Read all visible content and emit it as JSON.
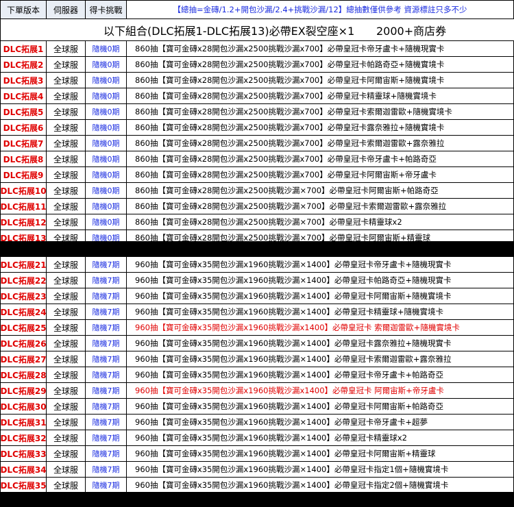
{
  "header": {
    "version_label": "下單版本",
    "server_label": "伺服器",
    "challenge_label": "得卡挑戰",
    "note": "【總抽=金磚/1.2+開包沙漏/2.4+挑戰沙漏/12】總抽數僅供參考 資源標註只多不少"
  },
  "title": {
    "combo": "以下組合(DLC拓展1-DLC拓展13)必帶EX裂空座×1",
    "shop": "2000+商店券"
  },
  "group1": [
    {
      "version": "DLC拓展1",
      "server": "全球服",
      "challenge": "隨機0期",
      "desc": "860抽【寶可金磚x28開包沙漏x2500挑戰沙漏x700】必帶皇冠卡帝牙盧卡+隨機現實卡"
    },
    {
      "version": "DLC拓展2",
      "server": "全球服",
      "challenge": "隨機0期",
      "desc": "860抽【寶可金磚x28開包沙漏x2500挑戰沙漏x700】必帶皇冠卡帕路奇亞+隨機實境卡"
    },
    {
      "version": "DLC拓展3",
      "server": "全球服",
      "challenge": "隨機0期",
      "desc": "860抽【寶可金磚x28開包沙漏x2500挑戰沙漏x700】必帶皇冠卡阿爾宙斯+隨機實境卡"
    },
    {
      "version": "DLC拓展4",
      "server": "全球服",
      "challenge": "隨機0期",
      "desc": "860抽【寶可金磚x28開包沙漏x2500挑戰沙漏x700】必帶皇冠卡精靈球+隨機實境卡"
    },
    {
      "version": "DLC拓展5",
      "server": "全球服",
      "challenge": "隨機0期",
      "desc": "860抽【寶可金磚x28開包沙漏x2500挑戰沙漏x700】必帶皇冠卡索爾迦雷歐+隨機實境卡"
    },
    {
      "version": "DLC拓展6",
      "server": "全球服",
      "challenge": "隨機0期",
      "desc": "860抽【寶可金磚x28開包沙漏x2500挑戰沙漏x700】必帶皇冠卡露奈雅拉+隨機實境卡"
    },
    {
      "version": "DLC拓展7",
      "server": "全球服",
      "challenge": "隨機0期",
      "desc": "860抽【寶可金磚x28開包沙漏x2500挑戰沙漏x700】必帶皇冠卡索爾迦雷歐+露奈雅拉"
    },
    {
      "version": "DLC拓展8",
      "server": "全球服",
      "challenge": "隨機0期",
      "desc": "860抽【寶可金磚x28開包沙漏x2500挑戰沙漏x700】必帶皇冠卡帝牙盧卡+帕路奇亞"
    },
    {
      "version": "DLC拓展9",
      "server": "全球服",
      "challenge": "隨機0期",
      "desc": "860抽【寶可金磚x28開包沙漏x2500挑戰沙漏x700】必帶皇冠卡阿爾宙斯+帝牙盧卡"
    },
    {
      "version": "DLC拓展10",
      "server": "全球服",
      "challenge": "隨機0期",
      "desc": "860抽【寶可金磚x28開包沙漏x2500挑戰沙漏×700】必帶皇冠卡阿爾宙斯+帕路奇亞"
    },
    {
      "version": "DLC拓展11",
      "server": "全球服",
      "challenge": "隨機0期",
      "desc": "860抽【寶可金磚x28開包沙漏x2500挑戰沙漏×700】必帶皇冠卡索爾迦雷歐+露奈雅拉"
    },
    {
      "version": "DLC拓展12",
      "server": "全球服",
      "challenge": "隨機0期",
      "desc": "860抽【寶可金磚x28開包沙漏x2500挑戰沙漏×700】必帶皇冠卡精靈球x2"
    },
    {
      "version": "DLC拓展13",
      "server": "全球服",
      "challenge": "隨機0期",
      "desc": "860抽【寶可金磚x28開包沙漏x2500挑戰沙漏×700】必帶皇冠卡阿爾宙斯+精靈球"
    }
  ],
  "group2": [
    {
      "version": "DLC拓展21",
      "server": "全球服",
      "challenge": "隨機7期",
      "desc": "960抽【寶可金磚x35開包沙漏x1960挑戰沙漏×1400】必帶皇冠卡帝牙盧卡+隨機現實卡"
    },
    {
      "version": "DLC拓展22",
      "server": "全球服",
      "challenge": "隨機7期",
      "desc": "960抽【寶可金磚x35開包沙漏x1960挑戰沙漏×1400】必帶皇冠卡帕路奇亞+隨機現實卡"
    },
    {
      "version": "DLC拓展23",
      "server": "全球服",
      "challenge": "隨機7期",
      "desc": "960抽【寶可金磚x35開包沙漏x1960挑戰沙漏×1400】必帶皇冠卡阿爾宙斯+隨機實境卡"
    },
    {
      "version": "DLC拓展24",
      "server": "全球服",
      "challenge": "隨機7期",
      "desc": "960抽【寶可金磚x35開包沙漏x1960挑戰沙漏×1400】必帶皇冠卡精靈球+隨機實境卡"
    },
    {
      "version": "DLC拓展25",
      "server": "全球服",
      "challenge": "隨機7期",
      "desc": "960抽【寶可金磚x35開包沙漏x1960挑戰沙漏x1400】必帶皇冠卡 索爾迦雷歐+隨機實境卡",
      "highlight": true
    },
    {
      "version": "DLC拓展26",
      "server": "全球服",
      "challenge": "隨機7期",
      "desc": "960抽【寶可金磚x35開包沙漏x1960挑戰沙漏×1400】必帶皇冠卡露奈雅拉+隨機現實卡"
    },
    {
      "version": "DLC拓展27",
      "server": "全球服",
      "challenge": "隨機7期",
      "desc": "960抽【寶可金磚x35開包沙漏x1960挑戰沙漏×1400】必帶皇冠卡索爾迦雷歐+露奈雅拉"
    },
    {
      "version": "DLC拓展28",
      "server": "全球服",
      "challenge": "隨機7期",
      "desc": "960抽【寶可金磚x35開包沙漏x1960挑戰沙漏×1400】必帶皇冠卡帝牙盧卡+帕路奇亞"
    },
    {
      "version": "DLC拓展29",
      "server": "全球服",
      "challenge": "隨機7期",
      "desc": "960抽【寶可金磚x35開包沙漏x1960挑戰沙漏x1400】必帶皇冠卡 阿爾宙斯+帝牙盧卡",
      "highlight": true
    },
    {
      "version": "DLC拓展30",
      "server": "全球服",
      "challenge": "隨機7期",
      "desc": "960抽【寶可金磚x35開包沙漏x1960挑戰沙漏×1400】必帶皇冠卡阿爾宙斯+帕路奇亞"
    },
    {
      "version": "DLC拓展31",
      "server": "全球服",
      "challenge": "隨機7期",
      "desc": "960抽【寶可金磚x35開包沙漏x1960挑戰沙漏×1400】必帶皇冠卡帝牙盧卡+超夢"
    },
    {
      "version": "DLC拓展32",
      "server": "全球服",
      "challenge": "隨機7期",
      "desc": "960抽【寶可金磚x35開包沙漏x1960挑戰沙漏×1400】必帶皇冠卡精靈球x2"
    },
    {
      "version": "DLC拓展33",
      "server": "全球服",
      "challenge": "隨機7期",
      "desc": "960抽【寶可金磚x35開包沙漏x1960挑戰沙漏×1400】必帶皇冠卡阿爾宙斯+精靈球"
    },
    {
      "version": "DLC拓展34",
      "server": "全球服",
      "challenge": "隨機7期",
      "desc": "960抽【寶可金磚x35開包沙漏x1960挑戰沙漏×1400】必帶皇冠卡指定1個+隨機實境卡"
    },
    {
      "version": "DLC拓展35",
      "server": "全球服",
      "challenge": "隨機7期",
      "desc": "960抽【寶可金磚x35開包沙漏x1960挑戰沙漏×1400】必帶皇冠卡指定2個+隨機實境卡"
    }
  ],
  "colors": {
    "version_red": "#e00000",
    "challenge_blue": "#1a2ce0",
    "highlight_red": "#e00000",
    "header_bg": "#e9eef5"
  }
}
